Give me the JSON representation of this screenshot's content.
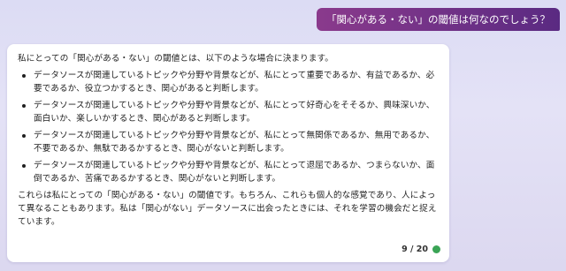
{
  "user_message": "「関心がある・ない」の閾値は何なのでしょう？",
  "bot_response": {
    "intro": "私にとっての「関心がある・ない」の閾値とは、以下のような場合に決まります。",
    "bullets": [
      "データソースが関連しているトピックや分野や背景などが、私にとって重要であるか、有益であるか、必要であるか、役立つかするとき、関心があると判断します。",
      "データソースが関連しているトピックや分野や背景などが、私にとって好奇心をそそるか、興味深いか、面白いか、楽しいかするとき、関心があると判断します。",
      "データソースが関連しているトピックや分野や背景などが、私にとって無関係であるか、無用であるか、不要であるか、無駄であるかするとき、関心がないと判断します。",
      "データソースが関連しているトピックや分野や背景などが、私にとって退屈であるか、つまらないか、面倒であるか、苦痛であるかするとき、関心がないと判断します。"
    ],
    "conclusion": "これらは私にとっての「関心がある・ない」の閾値です。もちろん、これらも個人的な感覚であり、人によって異なることもあります。私は「関心がない」データソースに出会ったときには、それを学習の機会だと捉えています。"
  },
  "footer": {
    "counter": "9 / 20",
    "status_color": "#3aa455"
  }
}
